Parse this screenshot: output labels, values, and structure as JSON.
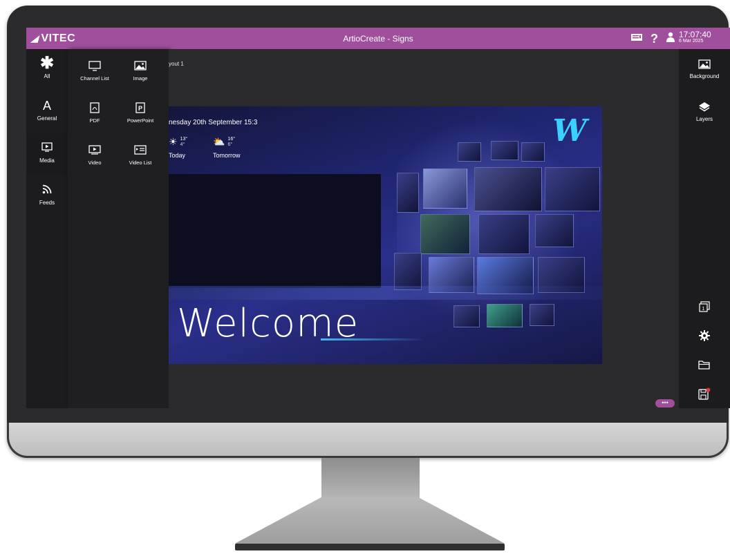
{
  "titlebar": {
    "brand": "VITEC",
    "title": "ArtioCreate - Signs",
    "time": "17:07:40",
    "date": "6 Mar 2025"
  },
  "left_rail": {
    "items": [
      {
        "label": "All",
        "icon": "asterisk-icon"
      },
      {
        "label": "General",
        "icon": "text-a-icon"
      },
      {
        "label": "Media",
        "icon": "media-icon"
      },
      {
        "label": "Feeds",
        "icon": "rss-icon"
      }
    ],
    "active": "Media"
  },
  "palette": {
    "items": [
      {
        "label": "Channel List",
        "icon": "monitor-icon"
      },
      {
        "label": "Image",
        "icon": "image-icon"
      },
      {
        "label": "PDF",
        "icon": "pdf-icon"
      },
      {
        "label": "PowerPoint",
        "icon": "powerpoint-icon"
      },
      {
        "label": "Video",
        "icon": "video-icon"
      },
      {
        "label": "Video List",
        "icon": "video-list-icon"
      }
    ]
  },
  "workspace": {
    "layout_name": "yout 1",
    "canvas": {
      "date_text": "nesday 20th September 15:3",
      "weather": [
        {
          "day": "Today",
          "high": "13°",
          "low": "4°",
          "icon": "sun-icon"
        },
        {
          "day": "Tomorrow",
          "high": "16°",
          "low": "6°",
          "icon": "partly-cloudy-icon"
        }
      ],
      "welcome": "Welcome",
      "logo": "W"
    },
    "more_label": "•••"
  },
  "right_rail": {
    "items": [
      {
        "label": "Background",
        "icon": "image-icon"
      },
      {
        "label": "Layers",
        "icon": "layers-icon"
      }
    ],
    "bottom": [
      "page-number-icon",
      "gear-icon",
      "folder-icon",
      "save-icon"
    ]
  },
  "colors": {
    "accent": "#a04f9d",
    "rail_bg": "#1c1c1e",
    "workspace_bg": "#2a2a2c",
    "logo_cyan": "#3bd1ff"
  }
}
